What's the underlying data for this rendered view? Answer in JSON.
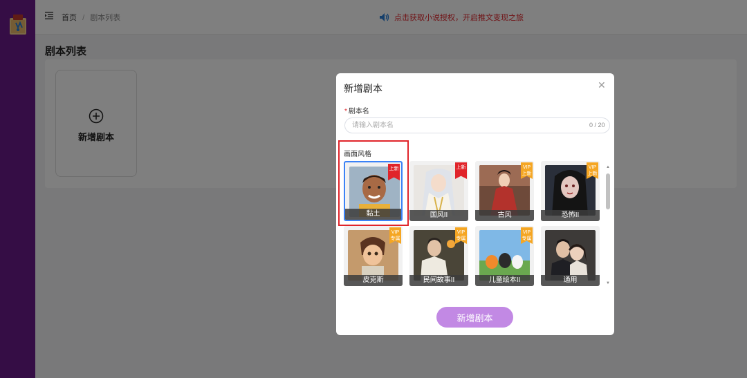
{
  "breadcrumb": {
    "home": "首页",
    "separator": "/",
    "current": "剧本列表"
  },
  "notice": {
    "text": "点击获取小说授权，开启推文变现之旅",
    "color": "#e0242a"
  },
  "page": {
    "title": "剧本列表"
  },
  "add_card": {
    "label": "新增剧本",
    "icon": "plus-circle-icon"
  },
  "modal": {
    "title": "新增剧本",
    "close_icon": "close-icon",
    "name_field": {
      "label": "剧本名",
      "required_mark": "*",
      "placeholder": "请输入剧本名",
      "value": "",
      "count": "0 / 20"
    },
    "style_section": {
      "label": "画面风格",
      "styles": [
        {
          "name": "黏土",
          "badge": "上新",
          "badge_type": "new",
          "selected": true
        },
        {
          "name": "国风II",
          "badge": "上新",
          "badge_type": "new",
          "selected": false
        },
        {
          "name": "古风",
          "badge": "VIP 上新",
          "badge_type": "vip",
          "selected": false
        },
        {
          "name": "恐怖II",
          "badge": "VIP 上新",
          "badge_type": "vip",
          "selected": false
        },
        {
          "name": "皮克斯",
          "badge": "VIP 专属",
          "badge_type": "vip",
          "selected": false
        },
        {
          "name": "民间故事II",
          "badge": "VIP 专属",
          "badge_type": "vip",
          "selected": false
        },
        {
          "name": "儿童绘本II",
          "badge": "VIP 专属",
          "badge_type": "vip",
          "selected": false
        },
        {
          "name": "通用",
          "badge": "",
          "badge_type": "",
          "selected": false
        }
      ]
    },
    "submit_label": "新增剧本"
  },
  "colors": {
    "sidebar": "#6b1a8a",
    "accent": "#c289e4",
    "selected_border": "#3b82f6",
    "highlight": "#e0242a"
  }
}
